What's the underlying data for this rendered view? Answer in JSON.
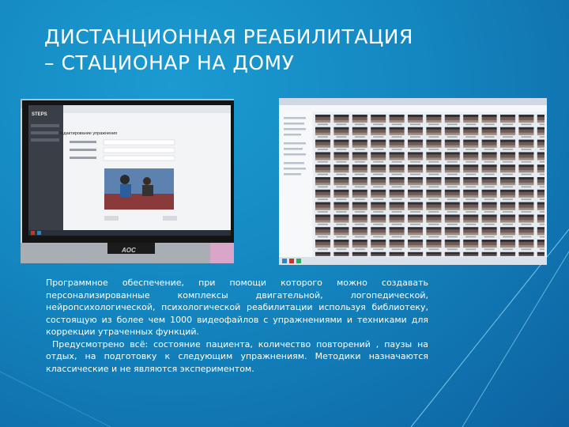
{
  "slide": {
    "title_line1": "ДИСТАНЦИОННАЯ РЕАБИЛИТАЦИЯ",
    "title_line2": "– СТАЦИОНАР НА ДОМУ",
    "paragraph1": "Программное обеспечение, при помощи которого можно создавать персонализированные комплексы двигательной, логопедической, нейропсихологической, психологической реабилитации используя библиотеку, состоящую из более чем 1000 видеофайлов с упражнениями и техниками для коррекции утраченных функций.",
    "paragraph2": "Предусмотрено всё: состояние пациента, количество повторений , паузы на отдых, на подготовку к следующим упражнениям. Методики назначаются классические и не являются экспериментом."
  },
  "left_photo": {
    "monitor_brand": "AOC",
    "app_logo": "STEPS",
    "dialog_title": "Редактирование упражнения"
  },
  "colors": {
    "background": "#1486c0",
    "accent_line": "#7fd0f2",
    "text": "#ffffff"
  }
}
